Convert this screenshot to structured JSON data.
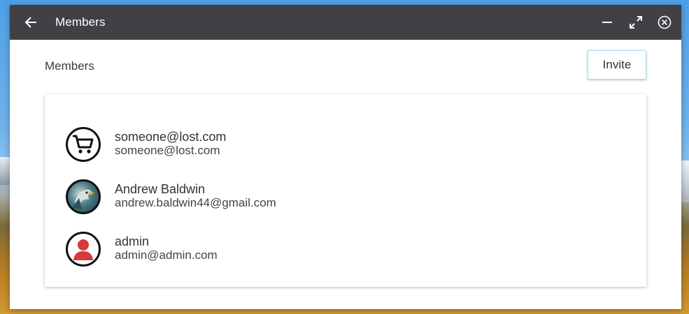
{
  "window": {
    "title": "Members"
  },
  "page": {
    "section_title": "Members",
    "invite_label": "Invite"
  },
  "members": [
    {
      "name": "someone@lost.com",
      "email": "someone@lost.com",
      "avatar": "shopping-cart-icon"
    },
    {
      "name": "Andrew Baldwin",
      "email": "andrew.baldwin44@gmail.com",
      "avatar": "user-photo"
    },
    {
      "name": "admin",
      "email": "admin@admin.com",
      "avatar": "person-icon"
    }
  ],
  "colors": {
    "titlebar": "#414045",
    "invite_border": "#9ee2f2",
    "person_icon": "#d63a3a"
  }
}
